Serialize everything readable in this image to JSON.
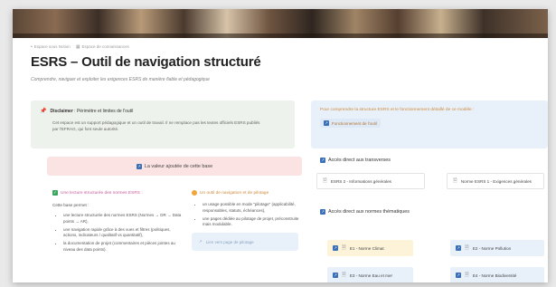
{
  "breadcrumb": {
    "items": [
      {
        "icon": "page-icon",
        "label": "Espace sous Notion"
      },
      {
        "icon": "grid-icon",
        "label": "Espace de connaissances"
      }
    ]
  },
  "page": {
    "title": "ESRS – Outil de navigation structuré",
    "subtitle": "Comprendre, naviguer et exploiter les exigences ESRS de manière fiable et pédagogique"
  },
  "disclaimer": {
    "icon": "pin-icon",
    "label": "Disclaimer",
    "label_rest": " : Périmètre et limites de l'outil",
    "body": "Cet espace est un support pédagogique et un outil de travail. Il ne remplace pas les textes officiels ESRS publiés par l'EFRAG, qui font seule autorité."
  },
  "structure_callout": {
    "text": "Pour comprendre la structure ESRS et le fonctionnement détaillé de ce modèle :",
    "button_label": "Fonctionnement de l'outil"
  },
  "value_box": {
    "label": "La valeur ajoutée de cette base"
  },
  "col_reading": {
    "heading": "Une lecture structurée des normes ESRS :",
    "intro": "Cette base permet :",
    "items": [
      "une lecture structurée des normes ESRS (Normes → DR → Data points → AR),",
      "une navigation rapide grâce à des vues et filtres (politiques, actions, indicateurs / qualitatif vs quantitatif),",
      "la documentation de projet (commentaires et pièces jointes au niveau des data points)."
    ]
  },
  "col_tool": {
    "heading": "Un outil de navigation et de pilotage",
    "items": [
      "un usage possible en mode \"pilotage\" (applicabilité, responsables, statuts, échéances),",
      "une pages dédiée au pilotage de projet, préconstruite mais modulable."
    ],
    "link_label": "Lien vers page de pilotage"
  },
  "transverse": {
    "title": "Accès direct aux transverses",
    "cards": [
      {
        "label": "ESRS 2 - Informations générales"
      },
      {
        "label": "Norme ESRS 1 - Exigences générales"
      }
    ]
  },
  "thematic": {
    "title": "Accès direct aux normes thématiques",
    "cards": [
      {
        "label": "E1 - Norme Climat"
      },
      {
        "label": "E2 - Norme Pollution"
      },
      {
        "label": "E3 - Norme Eau et mer"
      },
      {
        "label": "E4 - Norme Biodiversité"
      }
    ]
  },
  "colors": {
    "accent_pink": "#c95b9a",
    "accent_orange": "#d08a3c",
    "blue_square": "#3b6fb6",
    "callout_gray": "#eef2ec",
    "callout_blue": "#e8f1fa",
    "callout_pink": "#fbe3e3",
    "callout_yellow": "#fdf3d8"
  }
}
